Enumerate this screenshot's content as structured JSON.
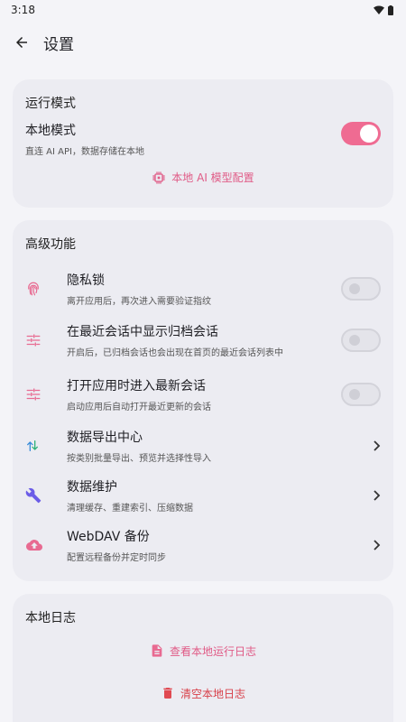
{
  "status": {
    "time": "3:18"
  },
  "header": {
    "title": "设置"
  },
  "mode_card": {
    "title": "运行模式",
    "local_mode_title": "本地模式",
    "local_mode_sub": "直连 AI API，数据存储在本地",
    "local_mode_on": true,
    "ai_config_label": "本地 AI 模型配置",
    "accent": "#ef6b92"
  },
  "advanced": {
    "title": "高级功能",
    "items": [
      {
        "title": "隐私锁",
        "sub": "离开应用后，再次进入需要验证指纹",
        "icon": "fingerprint-icon",
        "toggle_on": false
      },
      {
        "title": "在最近会话中显示归档会话",
        "sub": "开启后，已归档会话也会出现在首页的最近会话列表中",
        "icon": "tune-icon",
        "toggle_on": false
      },
      {
        "title": "打开应用时进入最新会话",
        "sub": "启动应用后自动打开最近更新的会话",
        "icon": "tune-icon",
        "toggle_on": false
      },
      {
        "title": "数据导出中心",
        "sub": "按类别批量导出、预览并选择性导入",
        "icon": "swap-vert-icon"
      },
      {
        "title": "数据维护",
        "sub": "清理缓存、重建索引、压缩数据",
        "icon": "wrench-icon"
      },
      {
        "title": "WebDAV 备份",
        "sub": "配置远程备份并定时同步",
        "icon": "cloud-upload-icon"
      }
    ]
  },
  "log_card": {
    "title": "本地日志",
    "view_label": "查看本地运行日志",
    "clear_label": "清空本地日志"
  }
}
